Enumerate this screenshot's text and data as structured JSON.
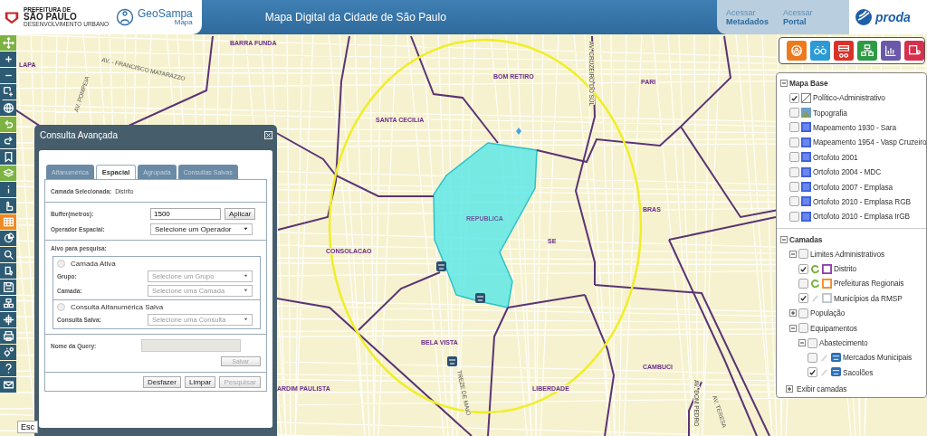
{
  "header": {
    "logo_lines": [
      "PREFEITURA DE",
      "SÃO PAULO"
    ],
    "logo_sub": "DESENVOLVIMENTO URBANO",
    "app_name": "GeoSampa",
    "app_sub": "Mapa",
    "title": "Mapa Digital da Cidade de São Paulo",
    "links": [
      {
        "line1": "Acessar",
        "line2": "Metadados"
      },
      {
        "line1": "Acessar",
        "line2": "Portal"
      }
    ],
    "partner": "proda"
  },
  "tools": [
    {
      "color": "#7cb342"
    },
    {
      "color": "#2d5b74"
    },
    {
      "color": "#2d5b74"
    },
    {
      "color": "#2d5b74"
    },
    {
      "color": "#2d5b74"
    },
    {
      "color": "#7cb342"
    },
    {
      "color": "#2d5b74"
    },
    {
      "color": "#2d5b74"
    },
    {
      "color": "#7cb342"
    },
    {
      "color": "#2d5b74"
    },
    {
      "color": "#2d5b74"
    },
    {
      "color": "#f08a24"
    },
    {
      "color": "#2d5b74"
    },
    {
      "color": "#2d5b74"
    },
    {
      "color": "#2d5b74"
    },
    {
      "color": "#2d5b74"
    },
    {
      "color": "#2d5b74"
    },
    {
      "color": "#2d5b74"
    },
    {
      "color": "#2d5b74"
    },
    {
      "color": "#2d5b74"
    },
    {
      "color": "#2d5b74"
    },
    {
      "color": "#2d5b74"
    }
  ],
  "apps": [
    {
      "color": "#ec7a1c"
    },
    {
      "color": "#2b9ad6"
    },
    {
      "color": "#d8332a"
    },
    {
      "color": "#2f9a45"
    },
    {
      "color": "#6a58a8"
    },
    {
      "color": "#d6304c"
    }
  ],
  "map": {
    "labels": [
      {
        "text": "BARRA FUNDA",
        "kind": "district"
      },
      {
        "text": "LAPA",
        "kind": "district"
      },
      {
        "text": "AV. - FRANCISCO MATARAZZO",
        "kind": "street"
      },
      {
        "text": "AV. POMPEIA",
        "kind": "street"
      },
      {
        "text": "BOM RETIRO",
        "kind": "district"
      },
      {
        "text": "PARI",
        "kind": "district"
      },
      {
        "text": "SANTA CECILIA",
        "kind": "district"
      },
      {
        "text": "REPUBLICA",
        "kind": "selected"
      },
      {
        "text": "SE",
        "kind": "district"
      },
      {
        "text": "BRAS",
        "kind": "district"
      },
      {
        "text": "CONSOLACAO",
        "kind": "district"
      },
      {
        "text": "BELA VISTA",
        "kind": "district"
      },
      {
        "text": "CAMBUCI",
        "kind": "district"
      },
      {
        "text": "LIBERDADE",
        "kind": "district"
      },
      {
        "text": "ARDIM PAULISTA",
        "kind": "district"
      },
      {
        "text": "TREZE DE MAIO",
        "kind": "street"
      },
      {
        "text": "AV. CRUZEIRO DO SUL",
        "kind": "street"
      },
      {
        "text": "AV. DOM PEDRO",
        "kind": "street"
      },
      {
        "text": "AV. TERESA",
        "kind": "street"
      }
    ],
    "scale_label": "Esc"
  },
  "dialog": {
    "title": "Consulta Avançada",
    "tabs": [
      {
        "label": "Alfanumérica",
        "selected": false
      },
      {
        "label": "Espacial",
        "selected": true
      },
      {
        "label": "Agrupada",
        "selected": false
      },
      {
        "label": "Consultas Salvas",
        "selected": false
      }
    ],
    "selected_layer": {
      "label": "Camada Selecionada:",
      "value": "Distrito"
    },
    "buffer": {
      "label": "Buffer(metros):",
      "value": "1500",
      "button": "Aplicar"
    },
    "operator": {
      "label": "Operador Espacial:",
      "value": "Selecione um Operador"
    },
    "target": {
      "title": "Alvo para pesquisa:",
      "options": [
        {
          "label": "Camada Ativa",
          "selected": false,
          "fields": [
            {
              "label": "Grupo:",
              "value": "Selecione um Grupo",
              "disabled": true
            },
            {
              "label": "Camada:",
              "value": "Selecione uma Camada",
              "disabled": true
            }
          ]
        },
        {
          "label": "Consulta Alfanumérica Salva",
          "selected": false,
          "fields": [
            {
              "label": "Consulta Salva:",
              "value": "Selecione uma Consulta",
              "disabled": true
            }
          ]
        }
      ]
    },
    "query": {
      "label": "Nome da Query:",
      "disabled": true,
      "button": "Salvar",
      "button_disabled": true
    },
    "actions": [
      {
        "label": "Desfazer",
        "disabled": false
      },
      {
        "label": "Limpar",
        "disabled": false
      },
      {
        "label": "Pesquisar",
        "disabled": true
      }
    ]
  },
  "layers": [
    {
      "label": "Mapa Base",
      "kind": "root",
      "expanded": true,
      "children": [
        {
          "label": "Político-Administrativo",
          "kind": "line",
          "checked": true
        },
        {
          "label": "Topografia",
          "kind": "topo",
          "checked": false
        },
        {
          "label": "Mapeamento 1930 - Sara",
          "kind": "raster",
          "checked": false
        },
        {
          "label": "Mapeamento 1954 - Vasp Cruzeiro",
          "kind": "raster",
          "checked": false
        },
        {
          "label": "Ortofoto 2001",
          "kind": "raster",
          "checked": false
        },
        {
          "label": "Ortofoto 2004 - MDC",
          "kind": "raster",
          "checked": false
        },
        {
          "label": "Ortofoto 2007 - Emplasa",
          "kind": "raster",
          "checked": false
        },
        {
          "label": "Ortofoto 2010 - Emplasa RGB",
          "kind": "raster",
          "checked": false
        },
        {
          "label": "Ortofoto 2010 - Emplasa IrGB",
          "kind": "raster",
          "checked": false
        }
      ]
    },
    {
      "label": "Camadas",
      "kind": "root",
      "expanded": true,
      "children": [
        {
          "label": "Limites Administrativos",
          "kind": "group",
          "checked": false,
          "expanded": true,
          "children": [
            {
              "label": "Distrito",
              "kind": "outline",
              "styled": true,
              "checked": true,
              "color": "#8e3fb0"
            },
            {
              "label": "Prefeituras Regionais",
              "kind": "outline",
              "styled": true,
              "checked": false,
              "color": "#f08a24"
            },
            {
              "label": "Municípios da RMSP",
              "kind": "outline",
              "styled": false,
              "checked": true,
              "color": "#bcc6cc"
            }
          ]
        },
        {
          "label": "População",
          "kind": "group",
          "checked": false,
          "expanded": false
        },
        {
          "label": "Equipamentos",
          "kind": "group",
          "checked": false,
          "expanded": true,
          "children": [
            {
              "label": "Abastecimento",
              "kind": "group",
              "checked": false,
              "expanded": true,
              "children": [
                {
                  "label": "Mercados Municipais",
                  "kind": "market",
                  "styled": false,
                  "checked": false
                },
                {
                  "label": "Sacolões",
                  "kind": "market",
                  "styled": false,
                  "checked": true
                }
              ]
            }
          ]
        }
      ]
    }
  ],
  "layers_footer": {
    "label": "Exibir camadas",
    "expanded": false
  }
}
